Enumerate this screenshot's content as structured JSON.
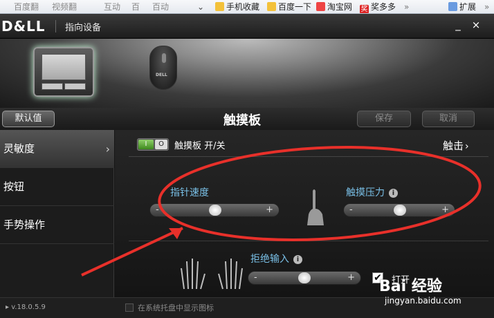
{
  "favorites_bar": {
    "items": [
      "手机收藏",
      "百度一下",
      "淘宝网",
      "奖多多"
    ],
    "faded": [
      "百度翻",
      "视频翻",
      "互动",
      "百",
      "百动"
    ],
    "more": "»",
    "expand": "扩展",
    "expand_more": "»"
  },
  "window": {
    "logo": "D&LL",
    "title": "指向设备",
    "minimize": "_",
    "close": "×"
  },
  "device_tabs": {
    "mouse_brand": "DELL"
  },
  "actions": {
    "default_label": "默认值",
    "page_title": "触摸板",
    "save_label": "保存",
    "cancel_label": "取消"
  },
  "sidebar": {
    "items": [
      {
        "label": "灵敏度"
      },
      {
        "label": "按钮"
      },
      {
        "label": "手势操作"
      }
    ],
    "chevron": "›"
  },
  "touchpad_toggle": {
    "on_text": "I",
    "off_text": "O",
    "label": "触摸板 开/关",
    "state": "on"
  },
  "tap_link": {
    "label": "触击",
    "chevron": "›"
  },
  "sliders": {
    "pointer_speed": {
      "label": "指针速度",
      "minus": "-",
      "plus": "+",
      "value": 0.5
    },
    "touch_pressure": {
      "label": "触摸压力",
      "minus": "-",
      "plus": "+",
      "value": 0.5
    },
    "palm_reject": {
      "label": "拒绝输入",
      "minus": "-",
      "plus": "+",
      "value": 0.5
    }
  },
  "info_glyph": "i",
  "palm_checkbox": {
    "label": "打开",
    "checked": true,
    "mark": "✔"
  },
  "status": {
    "version": "▸ v.18.0.5.9",
    "tray_label": "在系统托盘中显示图标"
  },
  "watermark": {
    "logo": "Bai 经验",
    "url": "jingyan.baidu.com"
  },
  "annotation_color": "#e8302a"
}
